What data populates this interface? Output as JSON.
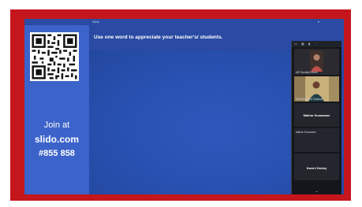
{
  "window": {
    "title": "Slido",
    "caret": "▾"
  },
  "slido": {
    "join_label": "Join at",
    "join_domain": "slido.com",
    "join_code": "#855 858",
    "question": "Use one word to appreciate your teacher's/ students."
  },
  "participants": {
    "toolbar_icons": [
      "▭",
      "▦",
      "▮",
      "⋮"
    ],
    "tiles": [
      {
        "name": "AIR Spotlight Movie",
        "kind": "video"
      },
      {
        "name": "EDA Bharti KA Tulasima",
        "kind": "video"
      },
      {
        "name": "Malhar Sonawane",
        "kind": "name"
      },
      {
        "name": "Malhar Sonawane",
        "kind": "label"
      },
      {
        "name": "Kaveri Dubey",
        "kind": "name"
      }
    ],
    "more": "⌄"
  },
  "colors": {
    "frame": "#c4161c",
    "slido_blue": "#2e4fae",
    "sidebar_blue": "#3c63c9",
    "meeting_panel": "#15161b"
  }
}
